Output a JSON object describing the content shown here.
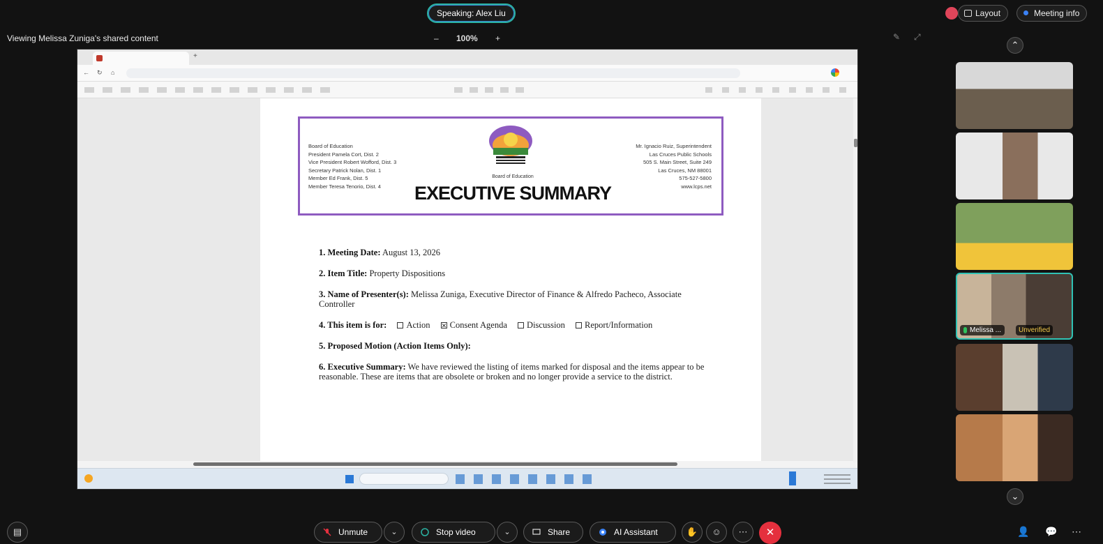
{
  "top_bar": {
    "speaking_label": "Speaking: Alex Liu",
    "layout_label": "Layout",
    "meeting_info_label": "Meeting info"
  },
  "share_banner": {
    "viewing_label": "Viewing Melissa Zuniga's shared content",
    "zoom_level": "100%",
    "zoom_minus": "–",
    "zoom_plus": "+"
  },
  "document": {
    "header": {
      "left_lines": "Board of Education\nPresident Pamela Cort, Dist. 2\nVice President Robert Wofford, Dist. 3\nSecretary Patrick Nolan, Dist. 1\nMember Ed Frank, Dist. 5\nMember Teresa Tenorio, Dist. 4",
      "right_lines": "Mr. Ignacio Ruiz, Superintendent\nLas Cruces Public Schools\n505 S. Main Street, Suite 249\nLas Cruces, NM 88001\n575-527-5800\nwww.lcps.net",
      "logo_caption": "Board of Education",
      "title": "EXECUTIVE SUMMARY"
    },
    "items": {
      "meeting_date_label": "1. Meeting Date:",
      "meeting_date_value": "August 13, 2026",
      "item_title_label": "2. Item Title:",
      "item_title_value": "Property Dispositions",
      "presenters_label": "3. Name of Presenter(s):",
      "presenters_value": "Melissa Zuniga, Executive Director of Finance & Alfredo Pacheco, Associate Controller",
      "item_for_label": "4. This item is for:",
      "option_action": "Action",
      "option_consent": "Consent Agenda",
      "option_discussion": "Discussion",
      "option_report": "Report/Information",
      "proposed_motion_label": "5. Proposed Motion (Action Items Only):",
      "exec_summary_label": "6. Executive Summary:",
      "exec_summary_value": "We have reviewed the listing of items marked for disposal and the items appear to be reasonable. These are items that are obsolete or broken and no longer provide a service to the district."
    }
  },
  "participants": {
    "active_name": "Melissa ...",
    "active_badge": "Unverified"
  },
  "bottom_bar": {
    "unmute_label": "Unmute",
    "stop_video_label": "Stop video",
    "share_label": "Share",
    "ai_assistant_label": "AI Assistant"
  },
  "colors": {
    "accent_teal": "#30c3b5",
    "end_call_red": "#e5303e",
    "doc_border_purple": "#8e5bc0"
  }
}
